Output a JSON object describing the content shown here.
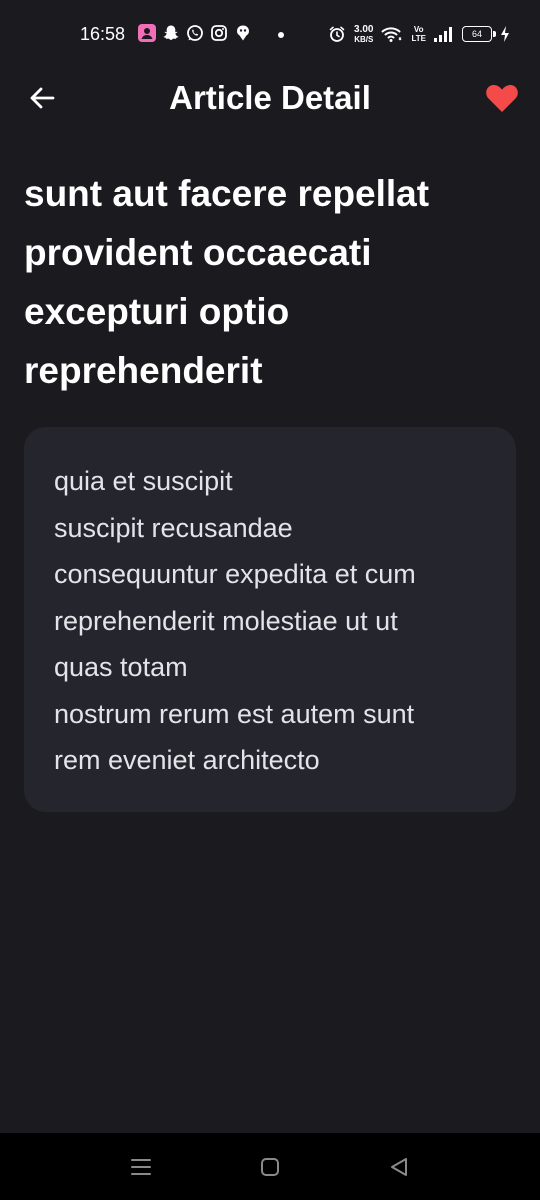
{
  "status_bar": {
    "time": "16:58",
    "net_speed_value": "3.00",
    "net_speed_unit": "KB/S",
    "volte_top": "Vo",
    "volte_bottom": "LTE",
    "battery": "64",
    "notification_icons": [
      "app-icon",
      "snapchat-icon",
      "whatsapp-icon",
      "instagram-icon",
      "app-icon"
    ]
  },
  "app_bar": {
    "title": "Article Detail",
    "back_icon": "arrow-left-icon",
    "favorite_icon": "heart-icon",
    "favorite_color": "#f44a4a"
  },
  "article": {
    "title": "sunt aut facere repellat provident occaecati excepturi optio reprehenderit",
    "body_lines": [
      "quia et suscipit",
      "suscipit recusandae",
      "consequuntur expedita et cum",
      "reprehenderit molestiae ut ut",
      "quas totam",
      "nostrum rerum est autem sunt",
      "rem eveniet architecto"
    ]
  },
  "nav_bar": {
    "items": [
      "recents-icon",
      "home-icon",
      "back-icon"
    ]
  },
  "colors": {
    "background": "#1b1b1f",
    "card": "#25252e",
    "text": "#ffffff",
    "body_text": "#e3e3e8"
  }
}
